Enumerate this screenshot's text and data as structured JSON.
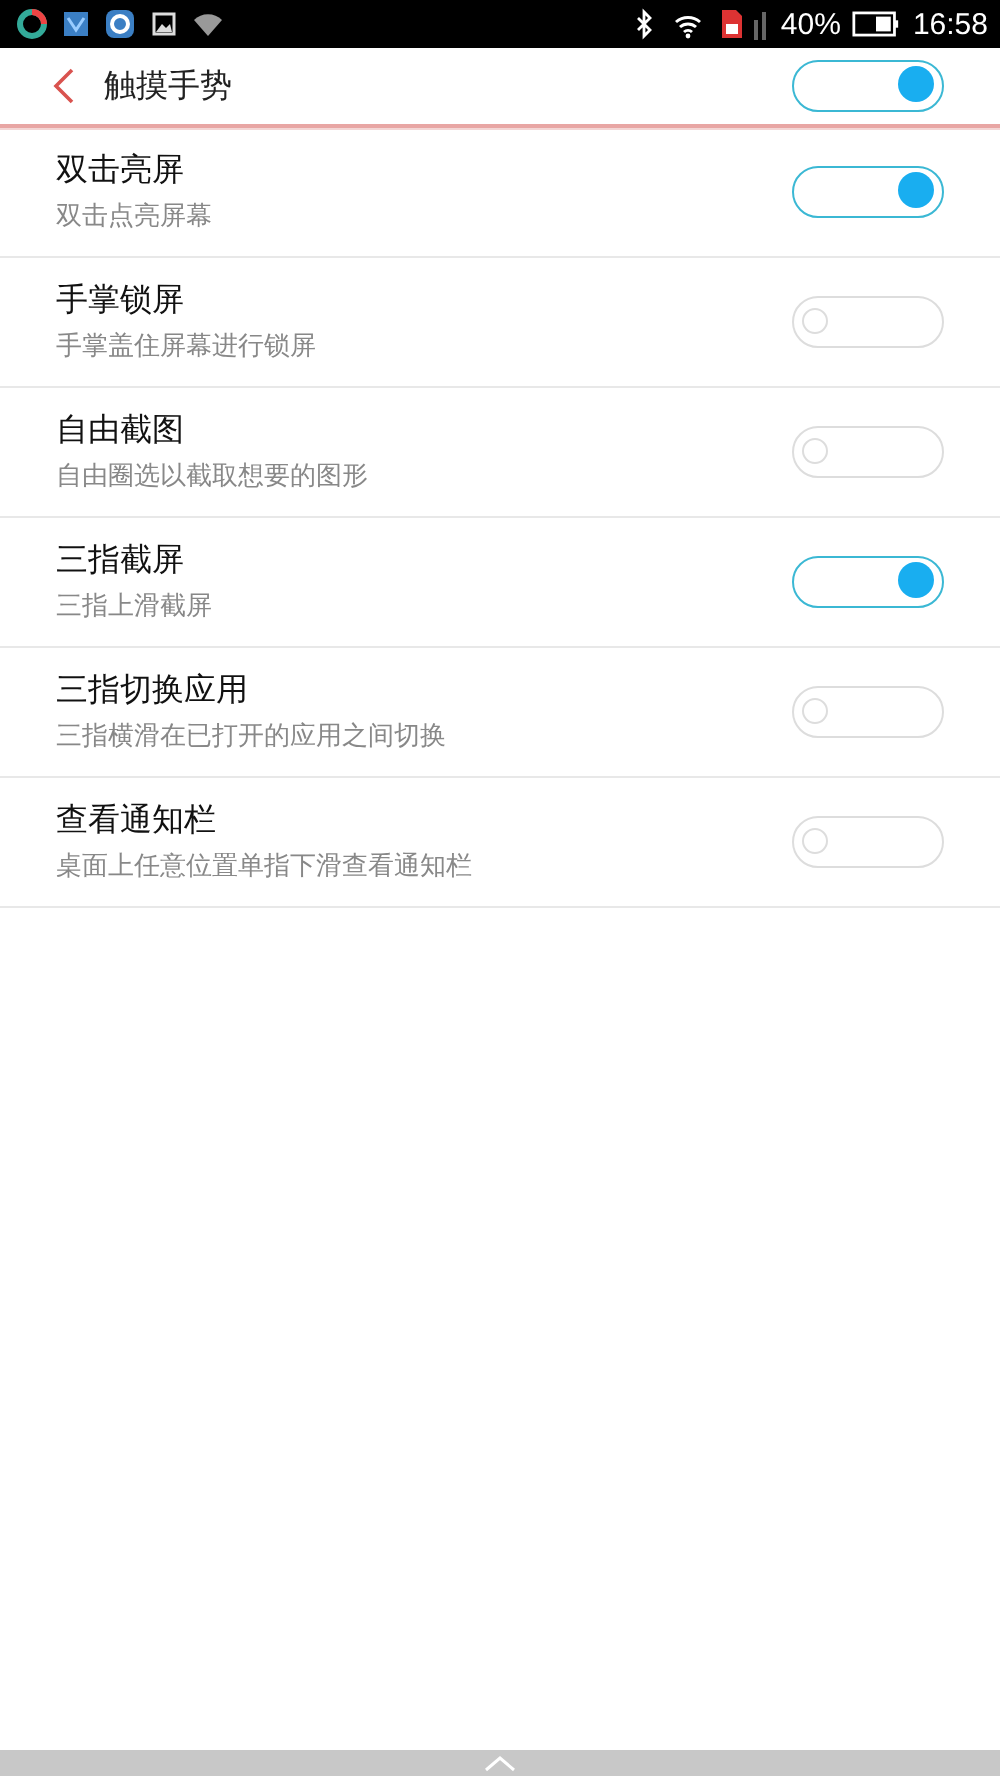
{
  "status_bar": {
    "battery_text": "40%",
    "time": "16:58"
  },
  "header": {
    "title": "触摸手势",
    "on": true
  },
  "settings": [
    {
      "title": "双击亮屏",
      "subtitle": "双击点亮屏幕",
      "on": true
    },
    {
      "title": "手掌锁屏",
      "subtitle": "手掌盖住屏幕进行锁屏",
      "on": false
    },
    {
      "title": "自由截图",
      "subtitle": "自由圈选以截取想要的图形",
      "on": false
    },
    {
      "title": "三指截屏",
      "subtitle": "三指上滑截屏",
      "on": true
    },
    {
      "title": "三指切换应用",
      "subtitle": "三指横滑在已打开的应用之间切换",
      "on": false
    },
    {
      "title": "查看通知栏",
      "subtitle": "桌面上任意位置单指下滑查看通知栏",
      "on": false
    }
  ]
}
